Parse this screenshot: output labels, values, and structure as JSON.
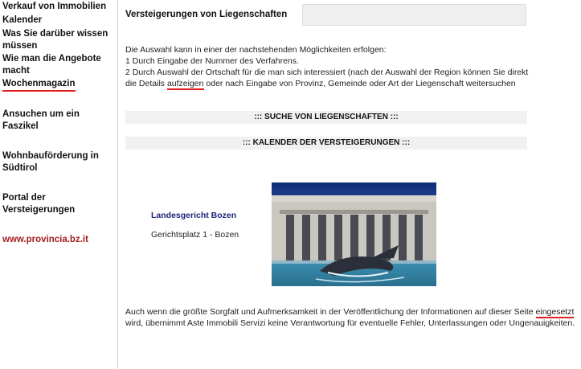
{
  "sidebar": {
    "items": [
      {
        "label": "Verkauf von Immobilien"
      },
      {
        "label": "Kalender"
      },
      {
        "label": "Was Sie darüber wissen müssen"
      },
      {
        "label": "Wie man die Angebote macht"
      },
      {
        "label": "Wochenmagazin"
      },
      {
        "label": "Ansuchen um ein Faszikel"
      },
      {
        "label": "Wohnbauförderung in Südtirol"
      },
      {
        "label": "Portal der Versteigerungen"
      },
      {
        "label": "www.provincia.bz.it"
      }
    ]
  },
  "main": {
    "title": "Versteigerungen von Liegenschaften",
    "intro": {
      "line1": "Die Auswahl kann in einer der nachstehenden Möglichkeiten erfolgen:",
      "line2": "1 Durch Eingabe der Nummer des Verfahrens.",
      "line3_a": "2 Durch Auswahl der Ortschaft für die man sich interessiert (nach der Auswahl der Region können Sie direkt die Details ",
      "line3_link": "aufzeigen",
      "line3_b": " oder nach Eingabe von Provinz, Gemeinde oder Art der Liegenschaft weitersuchen"
    },
    "search_bar": "::: SUCHE VON LIEGENSCHAFTEN :::",
    "calendar_bar": "::: KALENDER DER VERSTEIGERUNGEN :::",
    "court": {
      "name": "Landesgericht Bozen",
      "address": "Gerichtsplatz 1 - Bozen"
    },
    "disclaimer": {
      "a": "Auch wenn die größte Sorgfalt und Aufmerksamkeit in der Veröffentlichung der Informationen auf dieser Seite ",
      "link": "eingesetzt",
      "b": " wird, übernimmt Aste Immobili Servizi keine Verantwortung für eventuelle Fehler, Unterlassungen oder Ungenauigkeiten."
    }
  },
  "colors": {
    "accent_underline": "#e02020",
    "court_name": "#1c2379",
    "external_link": "#a51d1d",
    "bar_bg": "#f1f1f1"
  }
}
